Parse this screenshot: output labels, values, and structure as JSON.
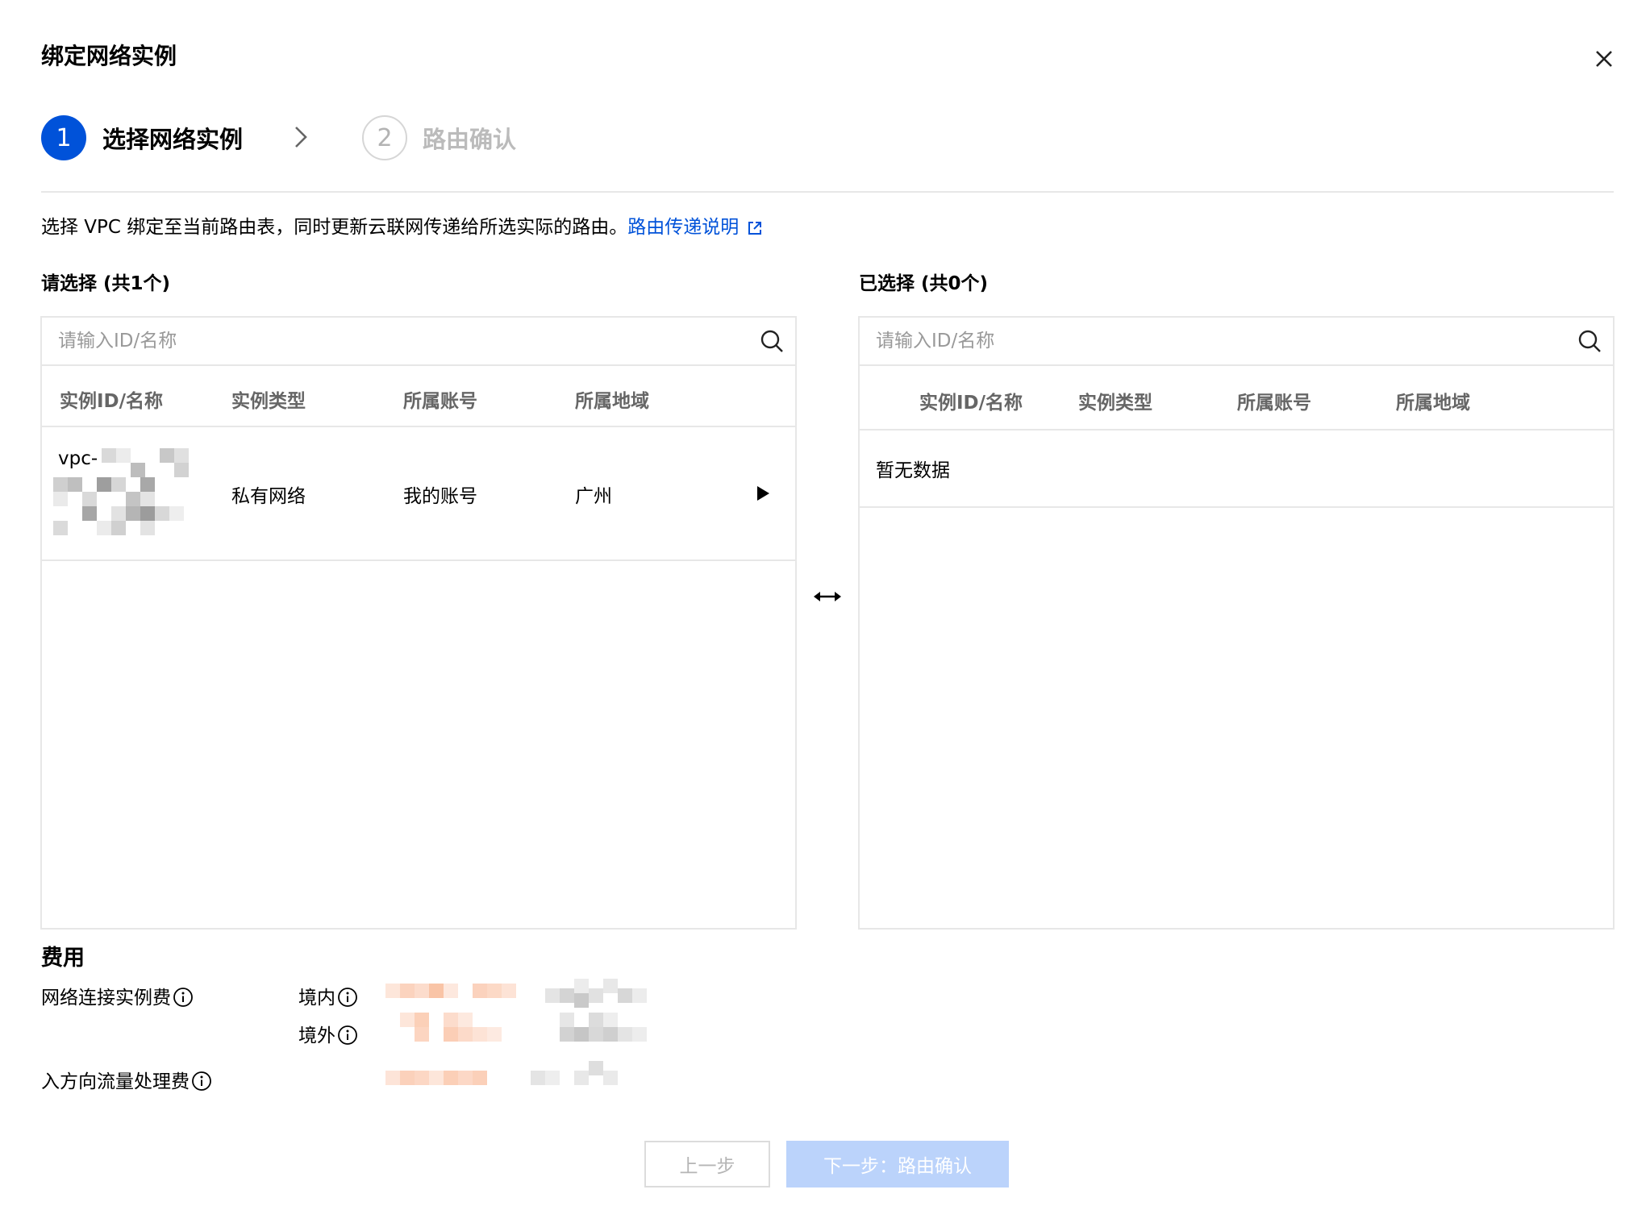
{
  "dialog": {
    "title": "绑定网络实例",
    "close_icon": "close-icon"
  },
  "steps": [
    {
      "number": "1",
      "label": "选择网络实例",
      "state": "active"
    },
    {
      "number": "2",
      "label": "路由确认",
      "state": "inactive"
    }
  ],
  "description": {
    "text": "选择 VPC 绑定至当前路由表，同时更新云联网传递给所选实际的路由。",
    "link": "路由传递说明"
  },
  "left_panel": {
    "title": "请选择 (共1个)",
    "search_placeholder": "请输入ID/名称",
    "columns": [
      "实例ID/名称",
      "实例类型",
      "所属账号",
      "所属地域"
    ],
    "rows": [
      {
        "id": "vpc-",
        "type": "私有网络",
        "account": "我的账号",
        "region": "广州"
      }
    ]
  },
  "right_panel": {
    "title": "已选择 (共0个)",
    "search_placeholder": "请输入ID/名称",
    "columns": [
      "实例ID/名称",
      "实例类型",
      "所属账号",
      "所属地域"
    ],
    "empty_text": "暂无数据"
  },
  "fees": {
    "title": "费用",
    "network_instance_fee": "网络连接实例费",
    "domestic": "境内",
    "overseas": "境外",
    "inbound_traffic_fee": "入方向流量处理费"
  },
  "footer": {
    "prev_label": "上一步",
    "next_label": "下一步：路由确认"
  },
  "colors": {
    "primary": "#0052d9",
    "disabled_primary": "#bbd3fb",
    "border": "#e7e7e7"
  }
}
